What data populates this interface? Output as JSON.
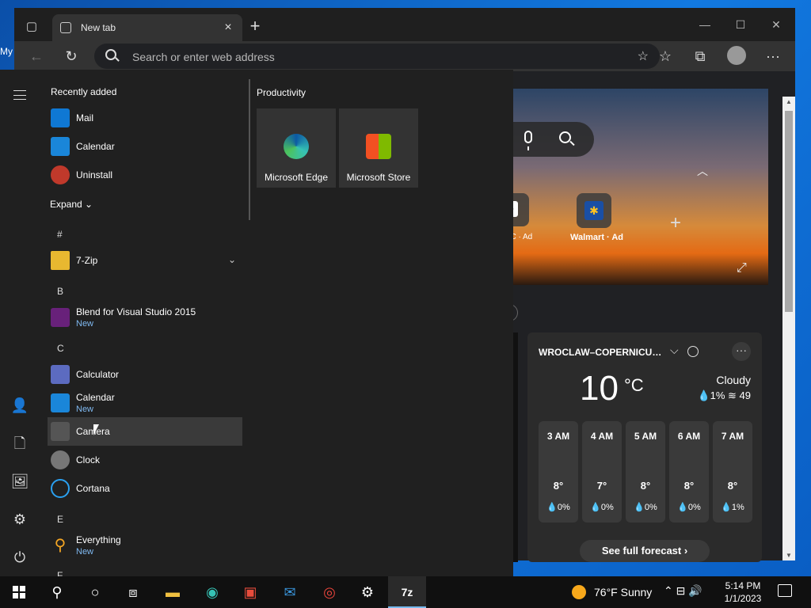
{
  "desktop": {
    "label": "My"
  },
  "browser": {
    "tab_title": "New tab",
    "tab_close": "×",
    "new_tab": "+",
    "address_placeholder": "Search or enter web address",
    "win_min": "—",
    "win_max": "☐",
    "win_close": "✕",
    "more": "···"
  },
  "newtab": {
    "qvc_label": "QVC · Ad",
    "walmart_label": "Walmart · Ad",
    "add": "+"
  },
  "weather": {
    "location": "WROCLAW–COPERNICU…",
    "temp": "10",
    "unit": "°C",
    "condition": "Cloudy",
    "stats": "💧1%  ≋ 49",
    "hours": [
      {
        "time": "3 AM",
        "temp": "8°",
        "precip": "💧0%"
      },
      {
        "time": "4 AM",
        "temp": "7°",
        "precip": "💧0%"
      },
      {
        "time": "5 AM",
        "temp": "8°",
        "precip": "💧0%"
      },
      {
        "time": "6 AM",
        "temp": "8°",
        "precip": "💧0%"
      },
      {
        "time": "7 AM",
        "temp": "8°",
        "precip": "💧1%"
      }
    ],
    "forecast_button": "See full forecast ›"
  },
  "start": {
    "recently_added": "Recently added",
    "recent": [
      {
        "name": "Mail",
        "color": "#0f78d4"
      },
      {
        "name": "Calendar",
        "color": "#1a86d9"
      },
      {
        "name": "Uninstall",
        "color": "#c0392b"
      }
    ],
    "expand": "Expand",
    "letters": {
      "hash": "#",
      "b": "B",
      "c": "C",
      "e": "E",
      "f": "F"
    },
    "apps": {
      "zip": "7-Zip",
      "blend": "Blend for Visual Studio 2015",
      "blend_sub": "New",
      "calculator": "Calculator",
      "calendar": "Calendar",
      "calendar_sub": "New",
      "camera": "Camera",
      "clock": "Clock",
      "cortana": "Cortana",
      "everything": "Everything",
      "everything_sub": "New"
    },
    "productivity": "Productivity",
    "tiles": [
      {
        "name": "Microsoft Edge"
      },
      {
        "name": "Microsoft Store"
      }
    ]
  },
  "taskbar": {
    "weather": "76°F  Sunny",
    "tray": "⌃  ⊟  🔊",
    "time": "5:14 PM",
    "date": "1/1/2023",
    "zip_label": "7z"
  },
  "colors": {
    "accent": "#76b9ed",
    "start_bg": "#202020",
    "taskbar_bg": "#101010"
  }
}
